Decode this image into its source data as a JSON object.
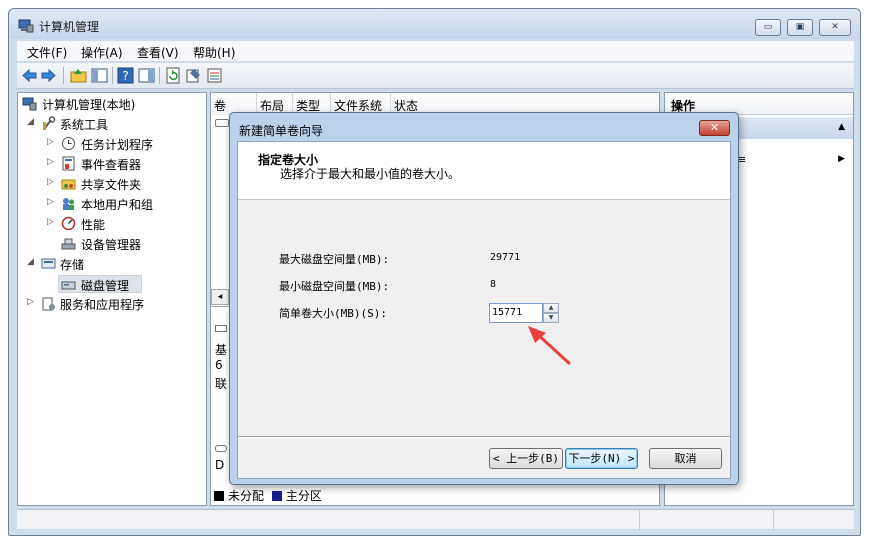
{
  "window": {
    "title": "计算机管理",
    "caption_buttons": [
      "▭",
      "▣",
      "✕"
    ]
  },
  "menubar": {
    "items": [
      "文件(F)",
      "操作(A)",
      "查看(V)",
      "帮助(H)"
    ]
  },
  "toolbar": {
    "icons": [
      "back-arrow-icon",
      "forward-arrow-icon",
      "up-folder-icon",
      "show-tree-icon",
      "help-icon",
      "action-pane-icon",
      "refresh-icon",
      "properties-icon",
      "export-icon"
    ]
  },
  "tree": {
    "root": "计算机管理(本地)",
    "items": [
      {
        "label": "系统工具",
        "icon": "tools-icon",
        "expanded": true
      },
      {
        "label": "任务计划程序",
        "icon": "clock-icon"
      },
      {
        "label": "事件查看器",
        "icon": "event-viewer-icon"
      },
      {
        "label": "共享文件夹",
        "icon": "shared-folder-icon"
      },
      {
        "label": "本地用户和组",
        "icon": "users-icon"
      },
      {
        "label": "性能",
        "icon": "performance-icon"
      },
      {
        "label": "设备管理器",
        "icon": "device-manager-icon"
      },
      {
        "label": "存储",
        "icon": "storage-icon",
        "expanded": true
      },
      {
        "label": "磁盘管理",
        "icon": "disk-icon",
        "selected": true
      },
      {
        "label": "服务和应用程序",
        "icon": "services-icon"
      }
    ]
  },
  "volume_table": {
    "columns": [
      "卷",
      "布局",
      "类型",
      "文件系统",
      "状态"
    ],
    "fragments": {
      "disk_a": "基",
      "disk_b": "6",
      "disk_c": "联",
      "disk_d": "D"
    }
  },
  "legend": [
    {
      "label": "未分配",
      "color": "#000000"
    },
    {
      "label": "主分区",
      "color": "#1a1a8c"
    }
  ],
  "actions": {
    "header": "操作"
  },
  "dialog": {
    "title": "新建简单卷向导",
    "close": "✕",
    "heading": "指定卷大小",
    "subheading": "选择介于最大和最小值的卷大小。",
    "fields": [
      {
        "label": "最大磁盘空间量(MB):",
        "value": "29771"
      },
      {
        "label": "最小磁盘空间量(MB):",
        "value": "8"
      }
    ],
    "size_field": {
      "label": "简单卷大小(MB)(S):",
      "value": "15771"
    },
    "buttons": {
      "back": "< 上一步(B)",
      "next": "下一步(N) >",
      "cancel": "取消"
    }
  },
  "colors": {
    "annotation_arrow": "#e8403c",
    "window_frame": "#cfdcea"
  }
}
